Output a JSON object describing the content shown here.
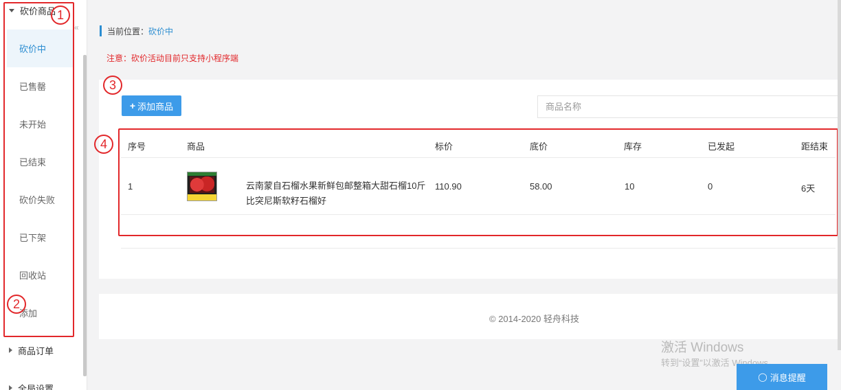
{
  "sidebar": {
    "group1_title": "砍价商品",
    "items": [
      "砍价中",
      "已售罄",
      "未开始",
      "已结束",
      "砍价失败",
      "已下架",
      "回收站",
      "添加"
    ],
    "group2_title": "商品订单",
    "group3_title": "全局设置",
    "collapse_glyph": "«"
  },
  "annotations": [
    "1",
    "2",
    "3",
    "4"
  ],
  "breadcrumb": {
    "prefix": "当前位置：",
    "current": "砍价中"
  },
  "notice": "注意：砍价活动目前只支持小程序端",
  "toolbar": {
    "add_label": "添加商品",
    "search_placeholder": "商品名称"
  },
  "table": {
    "headers": [
      "序号",
      "商品",
      "标价",
      "底价",
      "库存",
      "已发起",
      "距结束"
    ],
    "rows": [
      {
        "index": "1",
        "name": "云南蒙自石榴水果新鲜包邮整箱大甜石榴10斤比突尼斯软籽石榴好",
        "list_price": "110.90",
        "floor_price": "58.00",
        "stock": "10",
        "launched": "0",
        "remaining": "6天"
      }
    ]
  },
  "footer": {
    "copyright": "© 2014-2020 轻舟科技"
  },
  "watermark": {
    "line1": "激活 Windows",
    "line2": "转到“设置”以激活 Windows。"
  },
  "message_button": "消息提醒",
  "colors": {
    "accent": "#3d9be9",
    "annotation_red": "#e2272a",
    "link_blue": "#2b8dd1"
  }
}
